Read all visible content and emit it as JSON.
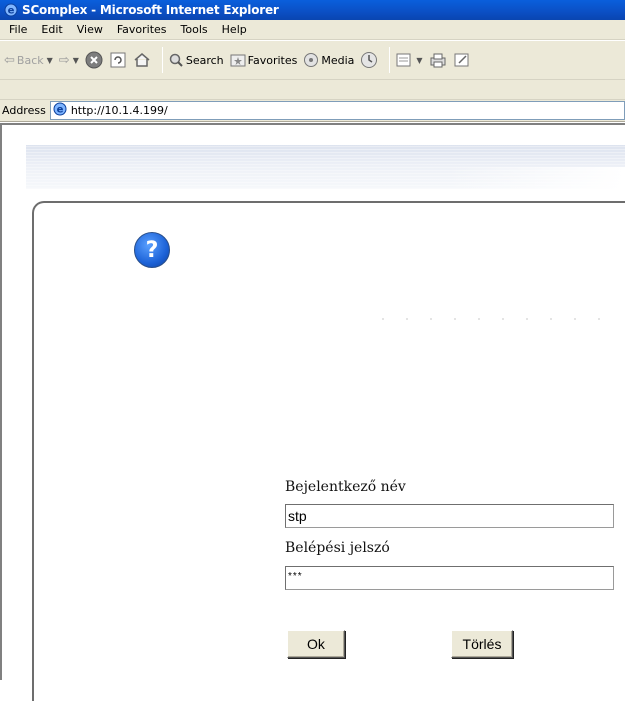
{
  "window": {
    "title": "SComplex - Microsoft Internet Explorer"
  },
  "menu": [
    "File",
    "Edit",
    "View",
    "Favorites",
    "Tools",
    "Help"
  ],
  "toolbar": {
    "back": "Back",
    "search": "Search",
    "favorites": "Favorites",
    "media": "Media"
  },
  "address": {
    "label": "Address",
    "url": "http://10.1.4.199/"
  },
  "form": {
    "username_label": "Bejelentkező név",
    "username_value": "stp",
    "password_label": "Belépési jelszó",
    "password_value": "***",
    "ok_label": "Ok",
    "clear_label": "Törlés"
  },
  "help": {
    "glyph": "?"
  }
}
